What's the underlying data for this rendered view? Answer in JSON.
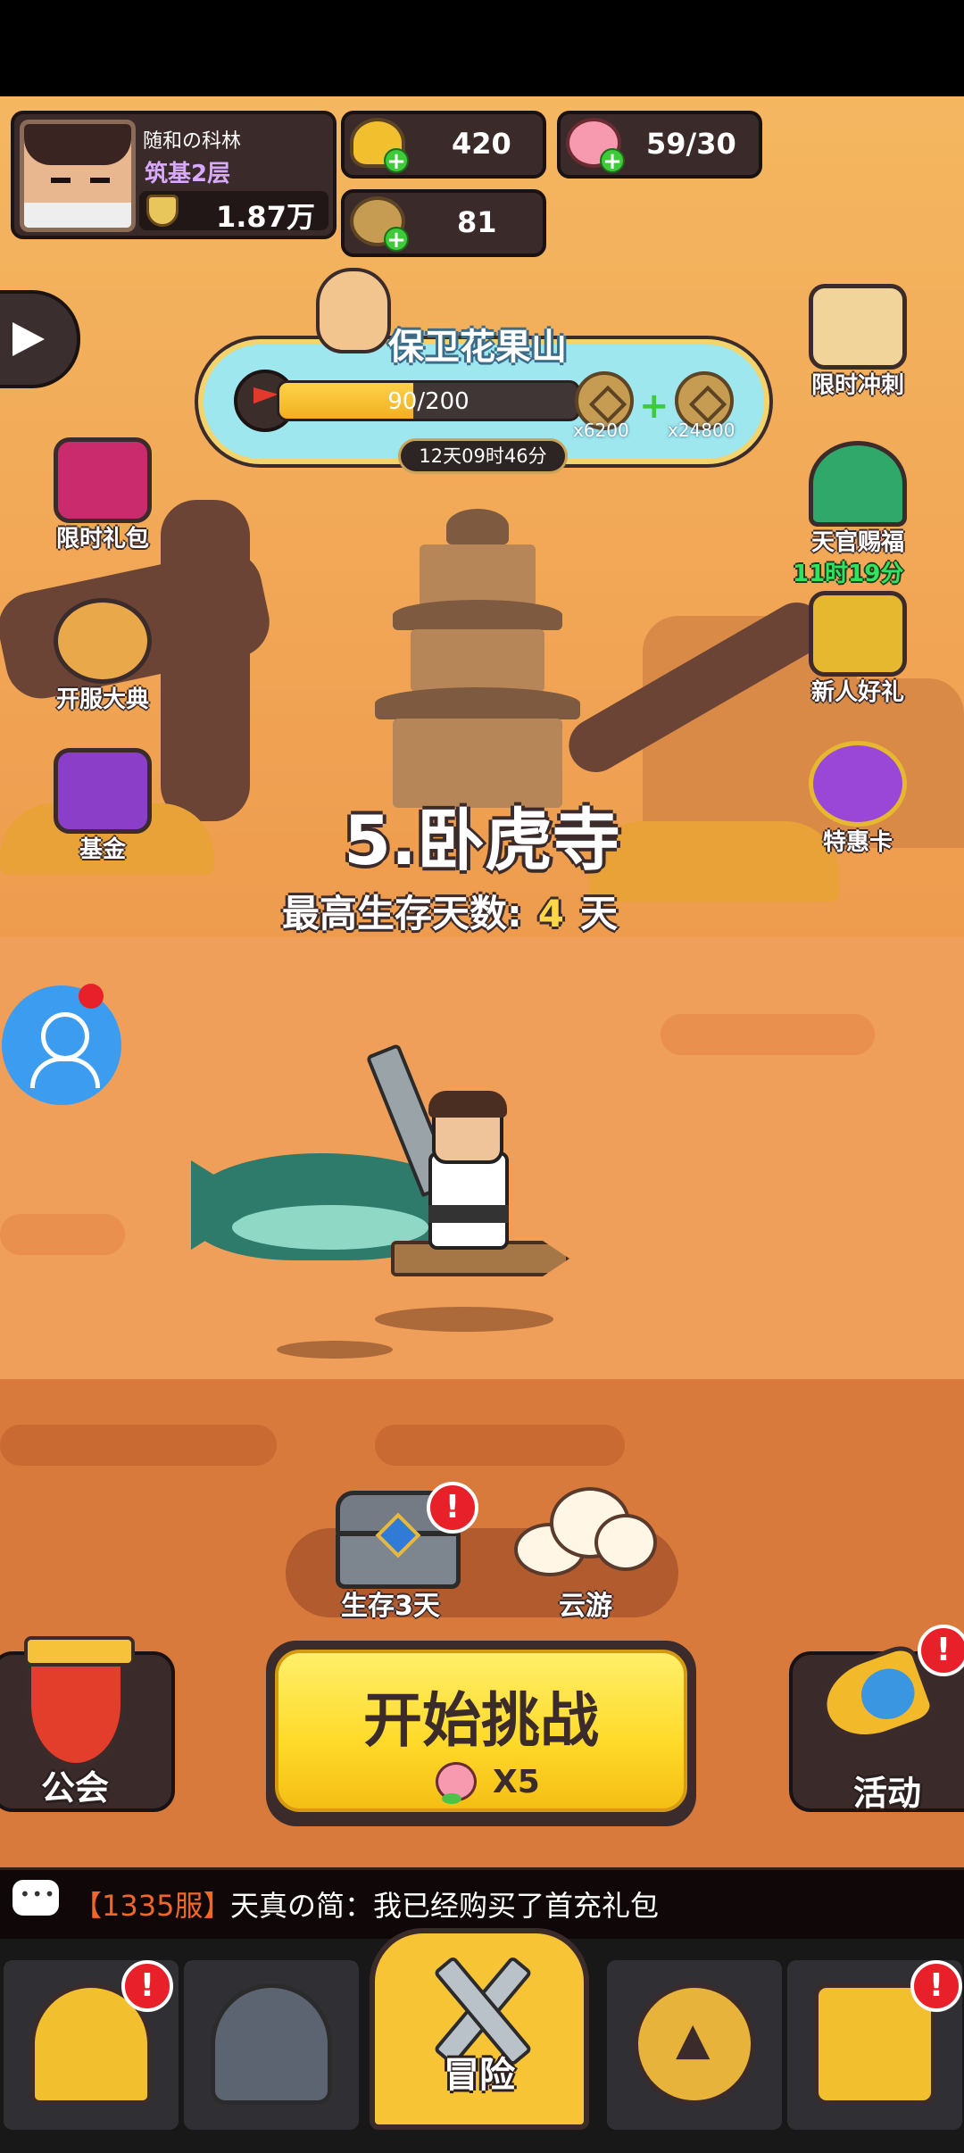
{
  "player": {
    "name": "随和の科林",
    "rank": "筑基2层",
    "power": "1.87万"
  },
  "resources": {
    "gold_ingot": "420",
    "peach": "59/30",
    "copper_coin": "81"
  },
  "event": {
    "title": "保卫花果山",
    "progress_text": "90/200",
    "progress_fraction": 0.45,
    "reward_1": "x6200",
    "reward_2": "x24800",
    "timer": "12天09时46分"
  },
  "side_left": {
    "limited_gift": "限时礼包",
    "server_launch": "开服大典",
    "fund": "基金"
  },
  "side_right": {
    "limited_rush": "限时冲刺",
    "heavenly_blessing": "天官赐福",
    "heavenly_blessing_timer": "11时19分",
    "newbie_gift": "新人好礼",
    "special_card": "特惠卡"
  },
  "stage": {
    "name": "5.卧虎寺",
    "survival_label": "最高生存天数:",
    "survival_days": "4",
    "survival_unit": "天"
  },
  "rewards": {
    "chest_label": "生存3天",
    "cloud_label": "云游",
    "alert": "!"
  },
  "actions": {
    "start": "开始挑战",
    "cost": "X5",
    "guild": "公会",
    "activity": "活动"
  },
  "chat": {
    "server": "【1335服】",
    "message": "天真の简：我已经购买了首充礼包"
  },
  "nav": {
    "adventure": "冒险"
  }
}
